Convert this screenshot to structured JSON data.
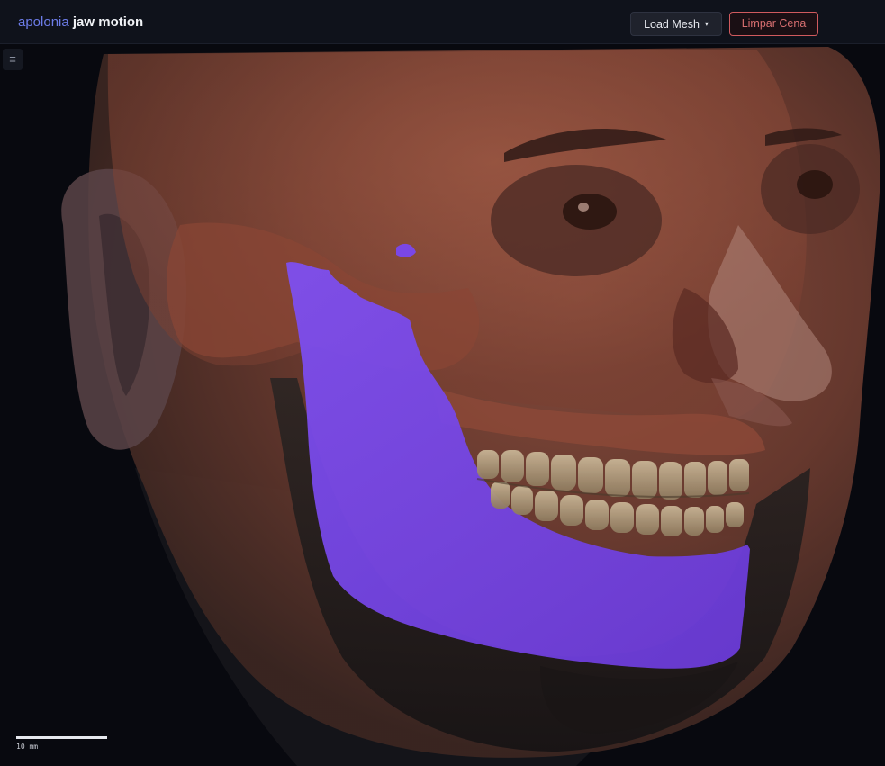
{
  "header": {
    "brand_name": "apolonia",
    "brand_sub": "jaw motion",
    "load_mesh_label": "Load Mesh",
    "load_mesh_caret": "▾",
    "clear_scene_label": "Limpar Cena"
  },
  "viewport": {
    "menu_icon": "≡",
    "scale_label": "10 mm"
  },
  "colors": {
    "accent": "#6c7ce8",
    "danger": "#d05a5e",
    "mandible": "#7a47e6",
    "skull": "#a0583f",
    "background": "#08090f"
  }
}
